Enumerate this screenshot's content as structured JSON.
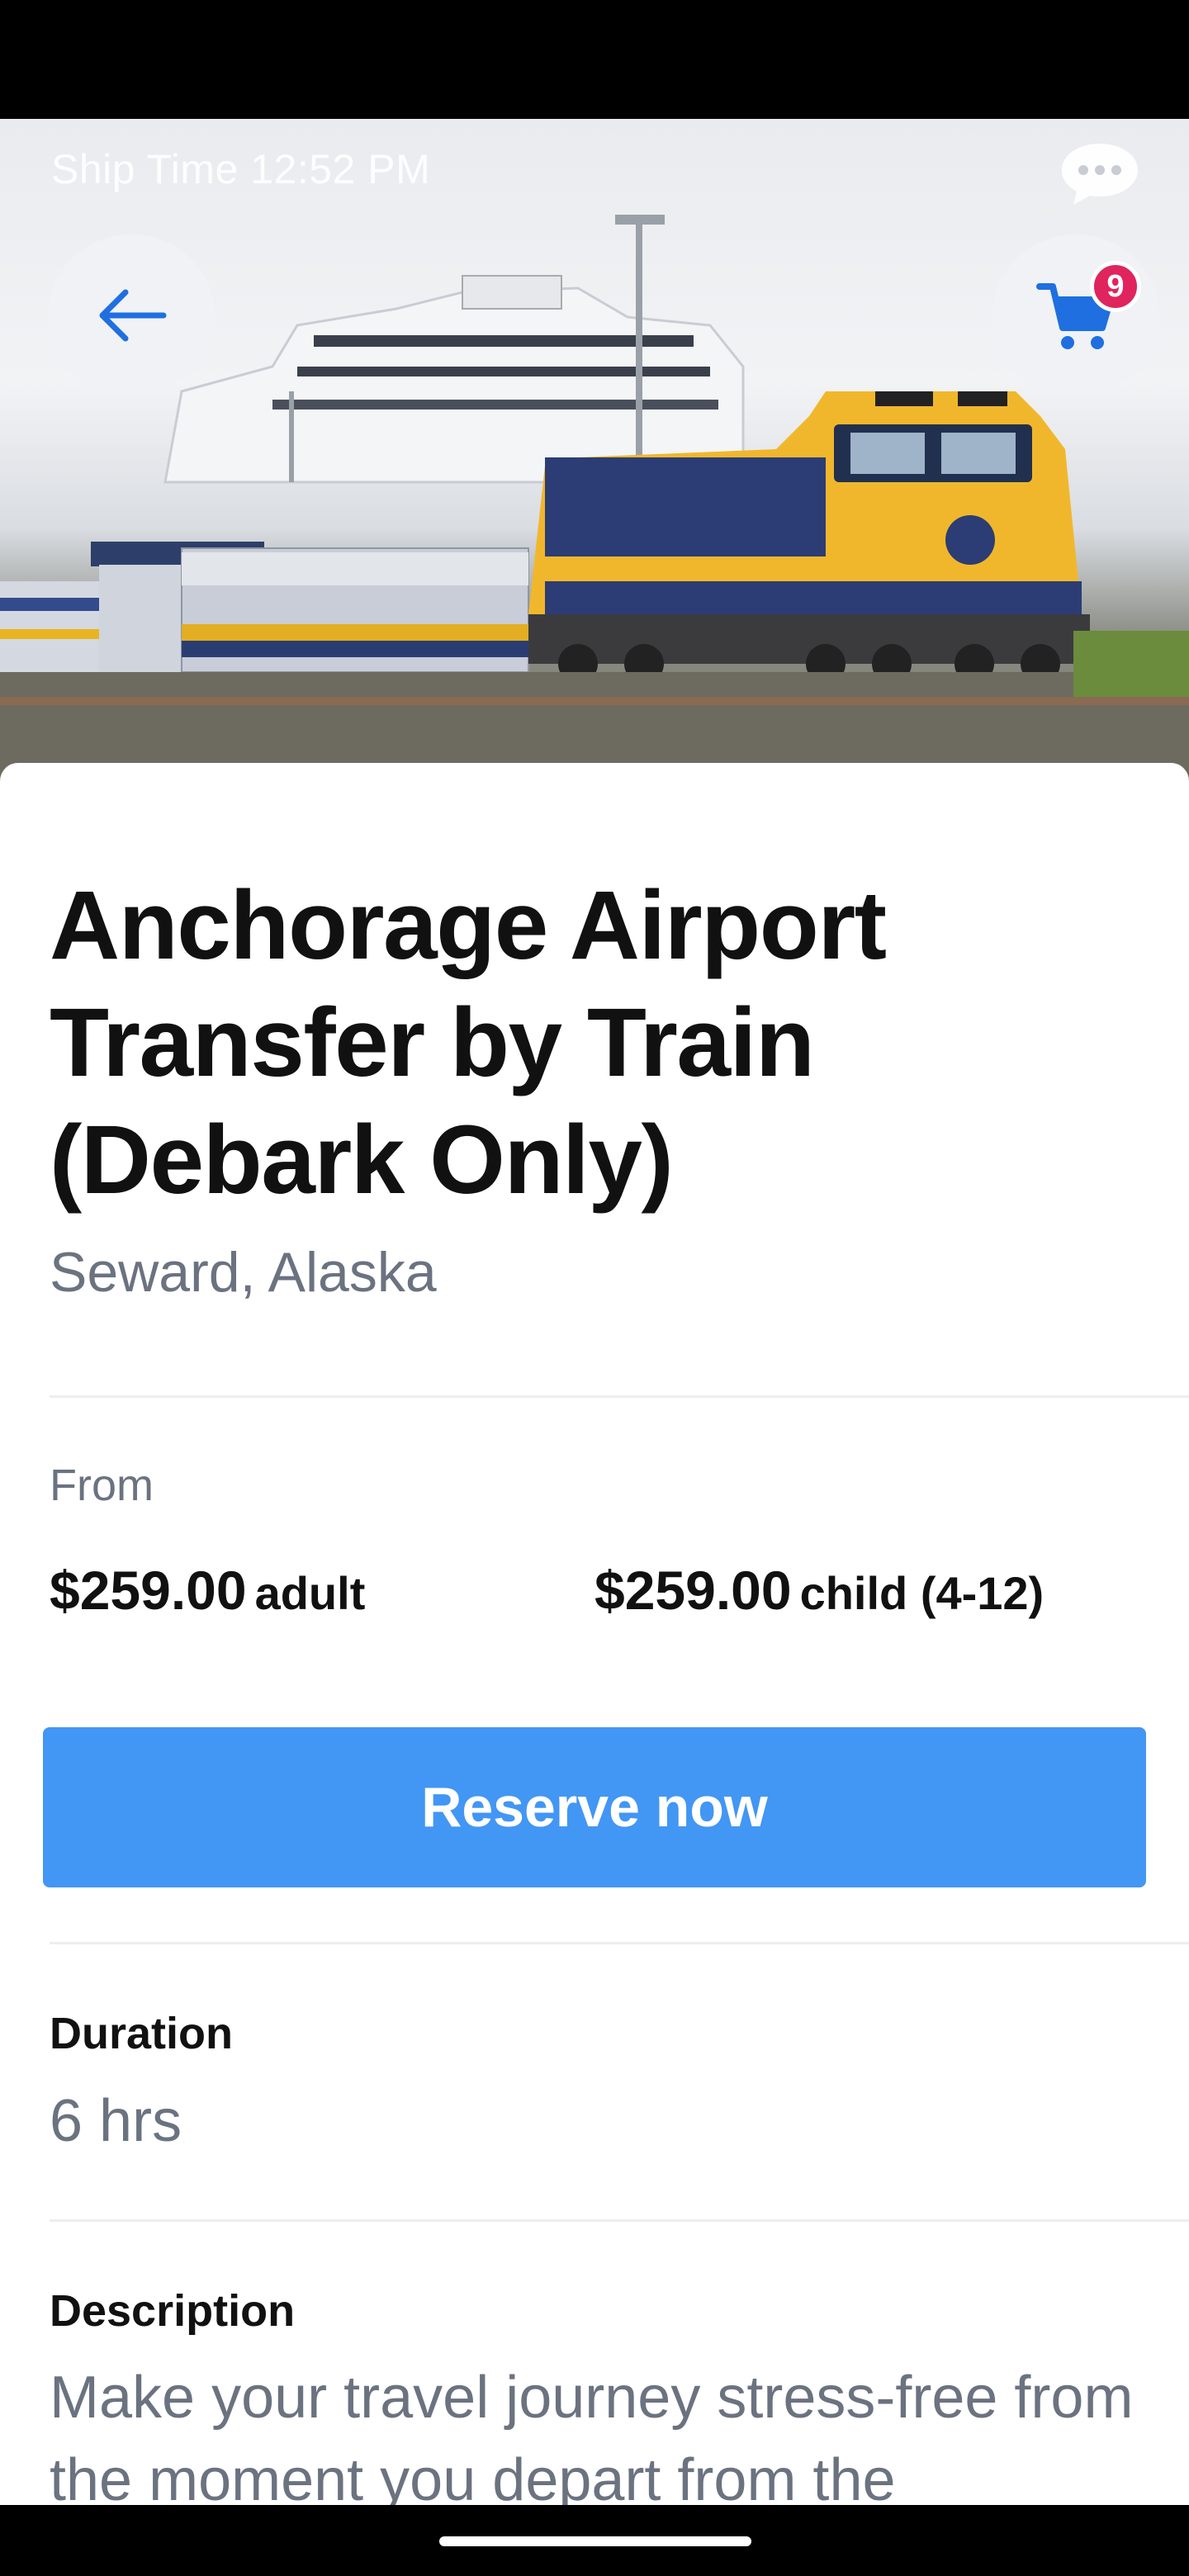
{
  "status": {
    "ship_time": "Ship Time 12:52 PM"
  },
  "header": {
    "cart_count": "9"
  },
  "product": {
    "title": "Anchorage Airport Transfer by Train (Debark Only)",
    "location": "Seward, Alaska"
  },
  "pricing": {
    "from_label": "From",
    "adult_price": "$259.00",
    "adult_label": "adult",
    "child_price": "$259.00",
    "child_label": "child (4-12)"
  },
  "cta": {
    "reserve_label": "Reserve now"
  },
  "details": {
    "duration_label": "Duration",
    "duration_value": "6 hrs",
    "description_label": "Description",
    "description_text": "Make your travel journey stress-free from the moment you depart from the"
  },
  "colors": {
    "accent": "#4296f4",
    "badge": "#e0245e",
    "icon_blue": "#1f6fe0"
  },
  "icons": {
    "back": "arrow-left-icon",
    "cart": "shopping-cart-icon",
    "chat": "chat-bubble-icon"
  }
}
